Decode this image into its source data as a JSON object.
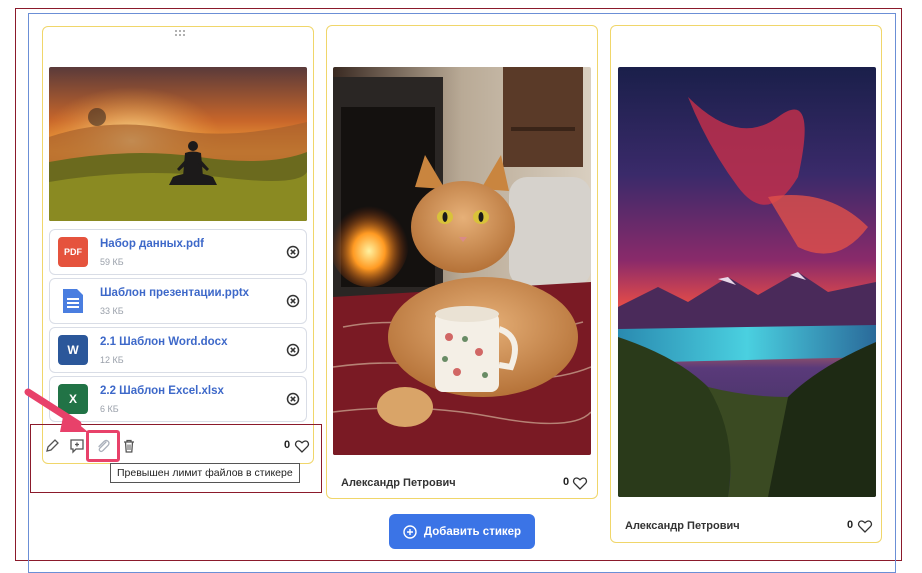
{
  "files": [
    {
      "name": "Набор данных.pdf",
      "size": "59 КБ",
      "icon": "pdf-icon",
      "color": "#e5533d",
      "badge": "PDF"
    },
    {
      "name": "Шаблон презентации.pptx",
      "size": "33 КБ",
      "icon": "doc-icon",
      "color": "#3d68c9",
      "badge": ""
    },
    {
      "name": "2.1 Шаблон Word.docx",
      "size": "12 КБ",
      "icon": "word-icon",
      "color": "#2b579a",
      "badge": "W"
    },
    {
      "name": "2.2 Шаблон Excel.xlsx",
      "size": "6 КБ",
      "icon": "excel-icon",
      "color": "#217346",
      "badge": "X"
    }
  ],
  "card1": {
    "likes": "0"
  },
  "card2": {
    "author": "Александр Петрович",
    "likes": "0"
  },
  "card3": {
    "author": "Александр Петрович",
    "likes": "0"
  },
  "tooltip": "Превышен лимит файлов в стикере",
  "add_button": {
    "label": "Добавить стикер"
  },
  "colors": {
    "accent": "#3b74e6",
    "highlight": "#e8416a",
    "card_border": "#f0d66a",
    "file_link": "#3d68c9"
  }
}
